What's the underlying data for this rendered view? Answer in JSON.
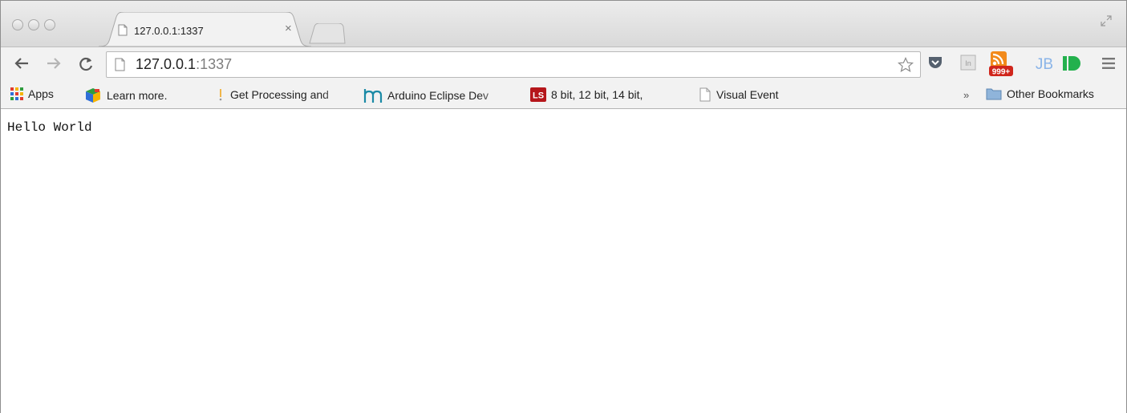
{
  "tab": {
    "title": "127.0.0.1:1337",
    "close_label": "×"
  },
  "toolbar": {
    "url_host": "127.0.0.1",
    "url_port": ":1337",
    "rss_badge": "999+",
    "ext_jb": "JB",
    "ext_in": "In"
  },
  "bookmarks": {
    "items": [
      {
        "label": "Apps",
        "icon": "apps-grid-icon"
      },
      {
        "label": "Learn more.",
        "icon": "google-cube-icon"
      },
      {
        "label": "Get Processing and",
        "icon": "processing-icon"
      },
      {
        "label": "Arduino Eclipse Dev",
        "icon": "arduino-eclipse-icon"
      },
      {
        "label": "8 bit, 12 bit, 14 bit,",
        "icon": "ls-icon",
        "icon_text": "LS"
      },
      {
        "label": "Visual Event",
        "icon": "page-icon"
      }
    ],
    "overflow_label": "»",
    "other_label": "Other Bookmarks"
  },
  "page": {
    "body_text": "Hello World"
  },
  "colors": {
    "ls_red": "#b5161b",
    "rss_orange": "#f28a1b",
    "jb_blue": "#8ab4e8",
    "id_green": "#23b14d",
    "pocket_gray": "#55606e"
  }
}
